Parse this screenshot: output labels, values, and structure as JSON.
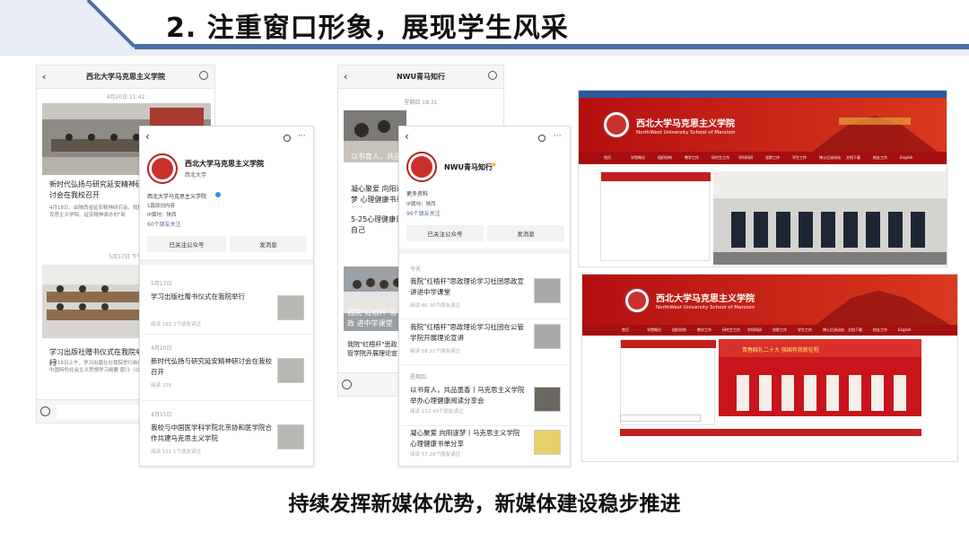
{
  "slide": {
    "title": "2. 注重窗口形象，展现学生风采",
    "caption": "持续发挥新媒体优势，新媒体建设稳步推进"
  },
  "phone1": {
    "header": "西北大学马克思主义学院",
    "time1": "4月20日 11:42",
    "article1_title": "新时代弘扬与研究延安精神研讨会在我校召开",
    "article1_summary": "4月18日，由陕西省延安精神研究会、我校马克思主义学院、延安精神承办的\"新",
    "time2": "5月17日 下午",
    "article2_title": "学习出版社赠书仪式在我院举行",
    "article2_summary": "5月16日上午，学习出版社在我院举行新时代中国特色社会主义思想学习纲要 版）》（以下",
    "profile": {
      "name": "西北大学马克思主义学院",
      "subtitle": "西北大学",
      "org": "西北大学马克思主义学院",
      "stat1": "1篇原创内容",
      "ip": "IP属地：陕西",
      "friends": "60个朋友关注",
      "btn_followed": "已关注公众号",
      "btn_message": "发消息"
    },
    "feed": [
      {
        "date": "5月17日",
        "title": "学习出版社赠书仪式在我院举行",
        "meta": "阅读 182  2个朋友读过"
      },
      {
        "date": "4月20日",
        "title": "新时代弘扬与研究延安精神研讨会在我校召开",
        "meta": "阅读 159"
      },
      {
        "date": "4月15日",
        "title": "我校与中国医学科学院北京协和医学院合作共建马克思主义学院",
        "meta": "阅读 121  1个朋友读过"
      }
    ]
  },
  "phone2": {
    "header": "NWU青马知行",
    "time": "星期四 18:31",
    "article1_title": "以书育人，共品墨香 办心理健康阅读分享",
    "article2_title": "凝心聚爱 向阳逐梦 心理健康书单分享",
    "article3_title": "5-25心理健康日 自己",
    "article4_title": "我院\"红梧杆\"思政 进中学课堂",
    "article5_title": "我院\"红梧杆\"思政 管学院开展理论宣",
    "profile": {
      "name": "NWU青马知行",
      "more": "更多资料",
      "ip": "IP属地：陕西",
      "friends": "96个朋友关注",
      "btn_followed": "已关注公众号",
      "btn_message": "发消息"
    },
    "feed": [
      {
        "date": "今天",
        "title": "我院\"红梧杆\"思政理论学习社团思政宣讲进中学课堂",
        "meta": "阅读 80  30个朋友读过"
      },
      {
        "date": "",
        "title": "我院\"红梧杆\"思政理论学习社团在公管学院开展理论宣讲",
        "meta": "阅读 58  21个朋友读过"
      },
      {
        "date": "星期四",
        "title": "以书育人，共品墨香丨马克思主义学院举办心理健康阅读分享会",
        "meta": "阅读 112  43个朋友读过"
      },
      {
        "date": "",
        "title": "凝心聚爱 向阳逐梦丨马克思主义学院心理健康书单分享",
        "meta": "阅读 57  28个朋友读过"
      }
    ]
  },
  "web1": {
    "site_name_cn": "西北大学马克思主义学院",
    "site_name_en": "NorthWest University School of Marxism",
    "nav": [
      "首页",
      "学院概况",
      "组织机构",
      "教学工作",
      "研究生工作",
      "学科科研",
      "党群工作",
      "学生工作",
      "博士后流动站",
      "文档下载",
      "校友工作",
      "English"
    ]
  },
  "web2": {
    "site_name_cn": "西北大学马克思主义学院",
    "site_name_en": "NorthWest University School of Marxism",
    "banner_text": "青春献礼二十大 强国有我新征程",
    "nav": [
      "首页",
      "学院概况",
      "组织机构",
      "教学工作",
      "研究生工作",
      "学科科研",
      "党群工作",
      "学生工作",
      "博士后流动站",
      "文档下载",
      "校友工作",
      "English"
    ]
  },
  "colors": {
    "title_bar_blue": "#4a6fa5",
    "accent_red": "#c41e1e",
    "nav_red": "#a50f10"
  }
}
